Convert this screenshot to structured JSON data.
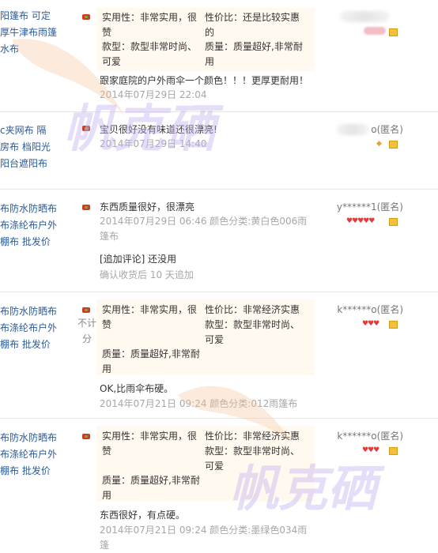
{
  "watermark": "帆克硒",
  "reviews": [
    {
      "product": [
        "阳篷布 可定",
        "厚牛津布雨篷",
        "水布"
      ],
      "tags": [
        {
          "label": "实用性：非常实用，很赞"
        },
        {
          "label": "性价比：还是比较实惠的"
        },
        {
          "label": "款型：款型非常时尚、可爱"
        },
        {
          "label": "质量：质量超好,非常耐用"
        }
      ],
      "text": "跟家庭院的户外雨伞一个颜色！！！更厚更耐用！",
      "date": "2014年07月29日 22:04",
      "user": ""
    },
    {
      "product": [
        "c夹网布 隔",
        "房布 档阳光",
        " 阳台遮阳布"
      ],
      "text": "宝贝很好没有味道还很漂亮!",
      "date": "2014年07月29日 14:40",
      "user": "o(匿名)"
    },
    {
      "product": [
        "布防水防晒布",
        "布涤纶布户外",
        "棚布 批发价"
      ],
      "text": "东西质量很好，很漂亮",
      "date": "2014年07月29日 06:46 颜色分类:黄白色006雨篷布",
      "append_text": "[追加评论] 还没用",
      "append_date": "确认收货后 10 天追加",
      "user": "y******1(匿名)"
    },
    {
      "product": [
        "布防水防晒布",
        "布涤纶布户外",
        "棚布 批发价"
      ],
      "nocount": "不计分",
      "tags": [
        {
          "label": "实用性：非常实用，很赞"
        },
        {
          "label": "性价比：非常经济实惠"
        },
        {
          "label": "款型：款型非常时尚、可爱"
        },
        {
          "label": "质量：质量超好,非常耐用"
        }
      ],
      "text": "OK,比雨伞布硬。",
      "date": "2014年07月21日 09:24 颜色分类:012雨篷布",
      "user": "k******o(匿名)"
    },
    {
      "product": [
        "布防水防晒布",
        "布涤纶布户外",
        "棚布 批发价"
      ],
      "tags": [
        {
          "label": "实用性：非常实用，很赞"
        },
        {
          "label": "性价比：非常经济实惠"
        },
        {
          "label": "款型：款型非常时尚、可爱"
        },
        {
          "label": "质量：质量超好,非常耐用"
        }
      ],
      "text": "东西很好，有点硬。",
      "date": "2014年07月21日 09:24 颜色分类:墨绿色034雨篷",
      "user": "k******o(匿名)"
    }
  ]
}
